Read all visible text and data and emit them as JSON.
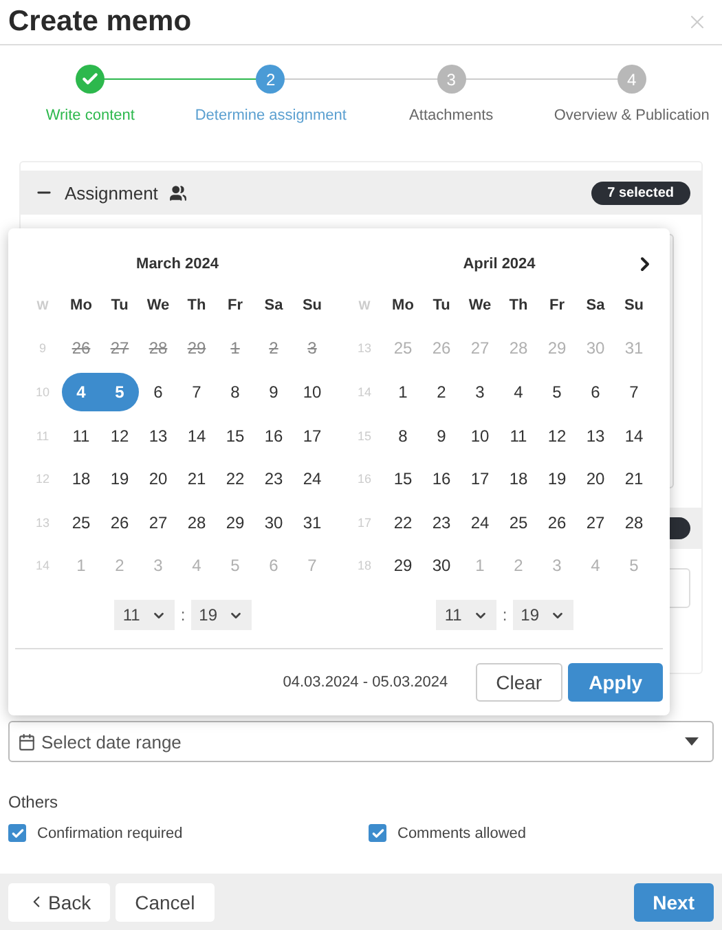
{
  "window": {
    "title": "Create memo"
  },
  "steps": [
    {
      "label": "Write content",
      "completed": true,
      "selected": false
    },
    {
      "number": "2",
      "label": "Determine assignment",
      "completed": false,
      "selected": true
    },
    {
      "number": "3",
      "label": "Attachments",
      "completed": false,
      "selected": false
    },
    {
      "number": "4",
      "label": "Overview & Publication",
      "completed": false,
      "selected": false
    }
  ],
  "assignment": {
    "title": "Assignment",
    "expanded": true,
    "badge": "7 selected"
  },
  "datepicker": {
    "months": [
      {
        "title": "March 2024",
        "week_header": "W",
        "weekdays": [
          "Mo",
          "Tu",
          "We",
          "Th",
          "Fr",
          "Sa",
          "Su"
        ],
        "hour": "11",
        "separator": ":",
        "minute": "19",
        "weeks": [
          {
            "week": "9",
            "days": [
              {
                "d": "26",
                "disabled": true,
                "outside": false,
                "selected": false
              },
              {
                "d": "27",
                "disabled": true,
                "outside": false,
                "selected": false
              },
              {
                "d": "28",
                "disabled": true,
                "outside": false,
                "selected": false
              },
              {
                "d": "29",
                "disabled": true,
                "outside": false,
                "selected": false
              },
              {
                "d": "1",
                "disabled": true,
                "outside": false,
                "selected": false
              },
              {
                "d": "2",
                "disabled": true,
                "outside": false,
                "selected": false
              },
              {
                "d": "3",
                "disabled": true,
                "outside": false,
                "selected": false
              }
            ]
          },
          {
            "week": "10",
            "days": [
              {
                "d": "4",
                "disabled": false,
                "outside": false,
                "selected": true
              },
              {
                "d": "5",
                "disabled": false,
                "outside": false,
                "selected": true
              },
              {
                "d": "6",
                "disabled": false,
                "outside": false,
                "selected": false
              },
              {
                "d": "7",
                "disabled": false,
                "outside": false,
                "selected": false
              },
              {
                "d": "8",
                "disabled": false,
                "outside": false,
                "selected": false
              },
              {
                "d": "9",
                "disabled": false,
                "outside": false,
                "selected": false
              },
              {
                "d": "10",
                "disabled": false,
                "outside": false,
                "selected": false
              }
            ]
          },
          {
            "week": "11",
            "days": [
              {
                "d": "11",
                "disabled": false,
                "outside": false,
                "selected": false
              },
              {
                "d": "12",
                "disabled": false,
                "outside": false,
                "selected": false
              },
              {
                "d": "13",
                "disabled": false,
                "outside": false,
                "selected": false
              },
              {
                "d": "14",
                "disabled": false,
                "outside": false,
                "selected": false
              },
              {
                "d": "15",
                "disabled": false,
                "outside": false,
                "selected": false
              },
              {
                "d": "16",
                "disabled": false,
                "outside": false,
                "selected": false
              },
              {
                "d": "17",
                "disabled": false,
                "outside": false,
                "selected": false
              }
            ]
          },
          {
            "week": "12",
            "days": [
              {
                "d": "18",
                "disabled": false,
                "outside": false,
                "selected": false
              },
              {
                "d": "19",
                "disabled": false,
                "outside": false,
                "selected": false
              },
              {
                "d": "20",
                "disabled": false,
                "outside": false,
                "selected": false
              },
              {
                "d": "21",
                "disabled": false,
                "outside": false,
                "selected": false
              },
              {
                "d": "22",
                "disabled": false,
                "outside": false,
                "selected": false
              },
              {
                "d": "23",
                "disabled": false,
                "outside": false,
                "selected": false
              },
              {
                "d": "24",
                "disabled": false,
                "outside": false,
                "selected": false
              }
            ]
          },
          {
            "week": "13",
            "days": [
              {
                "d": "25",
                "disabled": false,
                "outside": false,
                "selected": false
              },
              {
                "d": "26",
                "disabled": false,
                "outside": false,
                "selected": false
              },
              {
                "d": "27",
                "disabled": false,
                "outside": false,
                "selected": false
              },
              {
                "d": "28",
                "disabled": false,
                "outside": false,
                "selected": false
              },
              {
                "d": "29",
                "disabled": false,
                "outside": false,
                "selected": false
              },
              {
                "d": "30",
                "disabled": false,
                "outside": false,
                "selected": false
              },
              {
                "d": "31",
                "disabled": false,
                "outside": false,
                "selected": false
              }
            ]
          },
          {
            "week": "14",
            "days": [
              {
                "d": "1",
                "disabled": false,
                "outside": true,
                "selected": false
              },
              {
                "d": "2",
                "disabled": false,
                "outside": true,
                "selected": false
              },
              {
                "d": "3",
                "disabled": false,
                "outside": true,
                "selected": false
              },
              {
                "d": "4",
                "disabled": false,
                "outside": true,
                "selected": false
              },
              {
                "d": "5",
                "disabled": false,
                "outside": true,
                "selected": false
              },
              {
                "d": "6",
                "disabled": false,
                "outside": true,
                "selected": false
              },
              {
                "d": "7",
                "disabled": false,
                "outside": true,
                "selected": false
              }
            ]
          }
        ]
      },
      {
        "title": "April 2024",
        "next": true,
        "week_header": "W",
        "weekdays": [
          "Mo",
          "Tu",
          "We",
          "Th",
          "Fr",
          "Sa",
          "Su"
        ],
        "hour": "11",
        "separator": ":",
        "minute": "19",
        "weeks": [
          {
            "week": "13",
            "days": [
              {
                "d": "25",
                "disabled": false,
                "outside": true,
                "selected": false
              },
              {
                "d": "26",
                "disabled": false,
                "outside": true,
                "selected": false
              },
              {
                "d": "27",
                "disabled": false,
                "outside": true,
                "selected": false
              },
              {
                "d": "28",
                "disabled": false,
                "outside": true,
                "selected": false
              },
              {
                "d": "29",
                "disabled": false,
                "outside": true,
                "selected": false
              },
              {
                "d": "30",
                "disabled": false,
                "outside": true,
                "selected": false
              },
              {
                "d": "31",
                "disabled": false,
                "outside": true,
                "selected": false
              }
            ]
          },
          {
            "week": "14",
            "days": [
              {
                "d": "1",
                "disabled": false,
                "outside": false,
                "selected": false
              },
              {
                "d": "2",
                "disabled": false,
                "outside": false,
                "selected": false
              },
              {
                "d": "3",
                "disabled": false,
                "outside": false,
                "selected": false
              },
              {
                "d": "4",
                "disabled": false,
                "outside": false,
                "selected": false
              },
              {
                "d": "5",
                "disabled": false,
                "outside": false,
                "selected": false
              },
              {
                "d": "6",
                "disabled": false,
                "outside": false,
                "selected": false
              },
              {
                "d": "7",
                "disabled": false,
                "outside": false,
                "selected": false
              }
            ]
          },
          {
            "week": "15",
            "days": [
              {
                "d": "8",
                "disabled": false,
                "outside": false,
                "selected": false
              },
              {
                "d": "9",
                "disabled": false,
                "outside": false,
                "selected": false
              },
              {
                "d": "10",
                "disabled": false,
                "outside": false,
                "selected": false
              },
              {
                "d": "11",
                "disabled": false,
                "outside": false,
                "selected": false
              },
              {
                "d": "12",
                "disabled": false,
                "outside": false,
                "selected": false
              },
              {
                "d": "13",
                "disabled": false,
                "outside": false,
                "selected": false
              },
              {
                "d": "14",
                "disabled": false,
                "outside": false,
                "selected": false
              }
            ]
          },
          {
            "week": "16",
            "days": [
              {
                "d": "15",
                "disabled": false,
                "outside": false,
                "selected": false
              },
              {
                "d": "16",
                "disabled": false,
                "outside": false,
                "selected": false
              },
              {
                "d": "17",
                "disabled": false,
                "outside": false,
                "selected": false
              },
              {
                "d": "18",
                "disabled": false,
                "outside": false,
                "selected": false
              },
              {
                "d": "19",
                "disabled": false,
                "outside": false,
                "selected": false
              },
              {
                "d": "20",
                "disabled": false,
                "outside": false,
                "selected": false
              },
              {
                "d": "21",
                "disabled": false,
                "outside": false,
                "selected": false
              }
            ]
          },
          {
            "week": "17",
            "days": [
              {
                "d": "22",
                "disabled": false,
                "outside": false,
                "selected": false
              },
              {
                "d": "23",
                "disabled": false,
                "outside": false,
                "selected": false
              },
              {
                "d": "24",
                "disabled": false,
                "outside": false,
                "selected": false
              },
              {
                "d": "25",
                "disabled": false,
                "outside": false,
                "selected": false
              },
              {
                "d": "26",
                "disabled": false,
                "outside": false,
                "selected": false
              },
              {
                "d": "27",
                "disabled": false,
                "outside": false,
                "selected": false
              },
              {
                "d": "28",
                "disabled": false,
                "outside": false,
                "selected": false
              }
            ]
          },
          {
            "week": "18",
            "days": [
              {
                "d": "29",
                "disabled": false,
                "outside": false,
                "selected": false
              },
              {
                "d": "30",
                "disabled": false,
                "outside": false,
                "selected": false
              },
              {
                "d": "1",
                "disabled": false,
                "outside": true,
                "selected": false
              },
              {
                "d": "2",
                "disabled": false,
                "outside": true,
                "selected": false
              },
              {
                "d": "3",
                "disabled": false,
                "outside": true,
                "selected": false
              },
              {
                "d": "4",
                "disabled": false,
                "outside": true,
                "selected": false
              },
              {
                "d": "5",
                "disabled": false,
                "outside": true,
                "selected": false
              }
            ]
          }
        ]
      }
    ],
    "range": "04.03.2024 - 05.03.2024",
    "buttons": [
      "Clear",
      "Apply"
    ]
  },
  "date_field": {
    "placeholder": "Select date range"
  },
  "others": {
    "title": "Others",
    "options": [
      {
        "label": "Confirmation required",
        "checked": true
      },
      {
        "label": "Comments allowed",
        "checked": true
      }
    ]
  },
  "footer": {
    "back": "Back",
    "cancel": "Cancel",
    "next": "Next"
  }
}
